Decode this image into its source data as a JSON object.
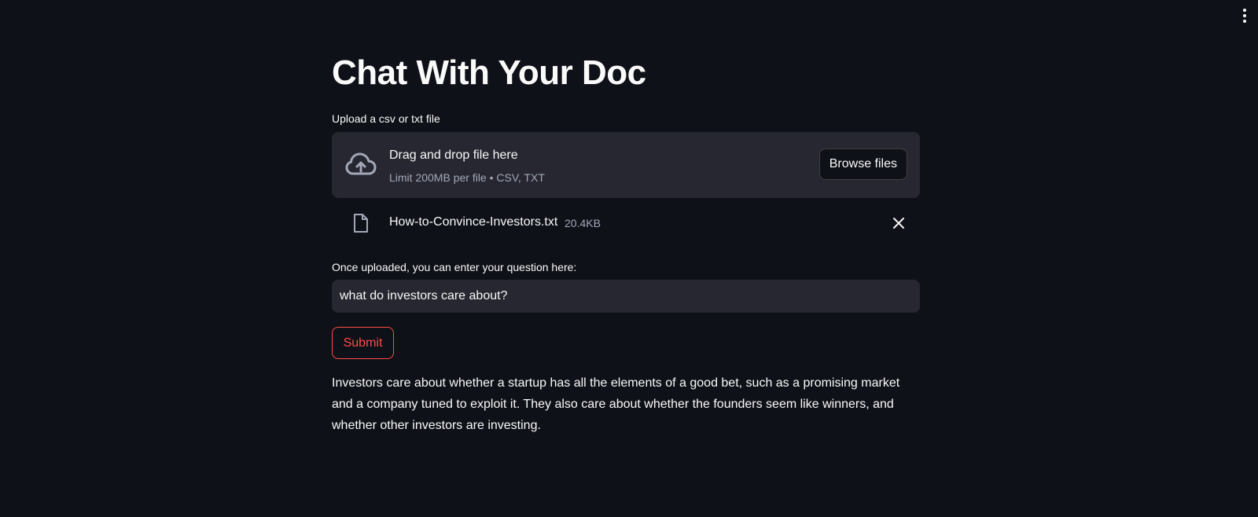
{
  "app": {
    "title": "Chat With Your Doc"
  },
  "menu": {
    "icon": "kebab-menu-icon"
  },
  "uploader": {
    "label": "Upload a csv or txt file",
    "icon": "cloud-upload-icon",
    "drop_text": "Drag and drop file here",
    "limit_text": "Limit 200MB per file • CSV, TXT",
    "browse_label": "Browse files"
  },
  "uploaded_file": {
    "icon": "file-icon",
    "name": "How-to-Convince-Investors.txt",
    "size": "20.4KB",
    "remove_icon": "close-icon"
  },
  "question": {
    "label": "Once uploaded, you can enter your question here:",
    "value": "what do investors care about?"
  },
  "submit": {
    "label": "Submit"
  },
  "answer": {
    "text": "Investors care about whether a startup has all the elements of a good bet, such as a promising market and a company tuned to exploit it. They also care about whether the founders seem like winners, and whether other investors are investing."
  },
  "colors": {
    "background": "#0e1117",
    "surface": "#262730",
    "text": "#fafafa",
    "muted": "#a3a8b8",
    "accent": "#ff4b4b"
  }
}
